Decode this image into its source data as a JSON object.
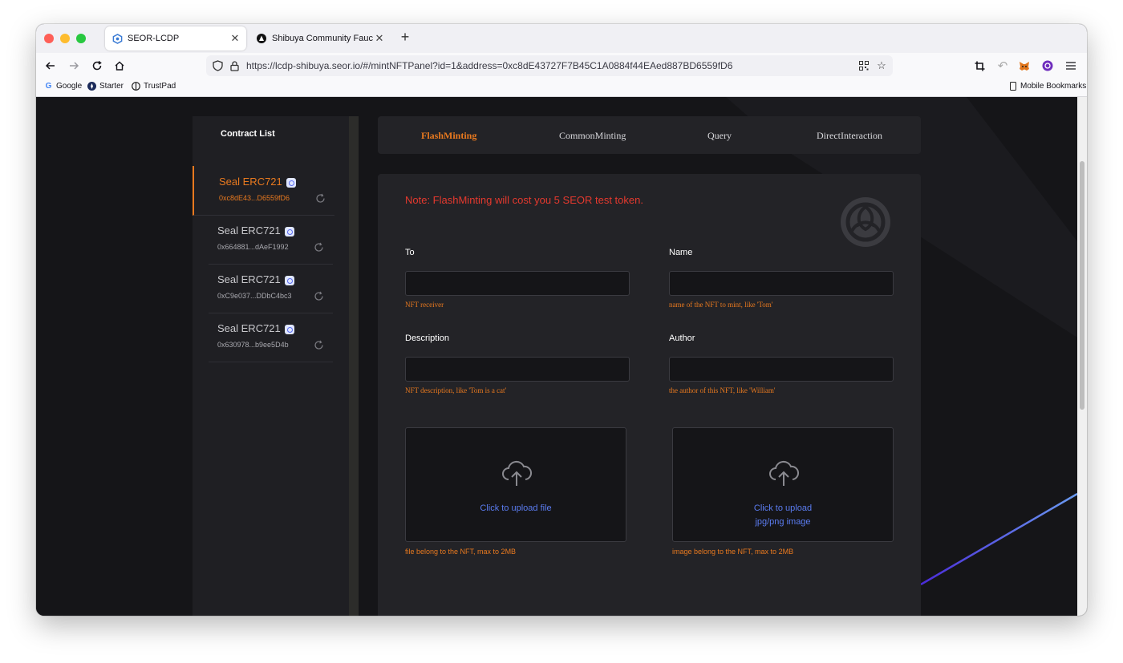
{
  "browser": {
    "tabs": [
      {
        "title": "SEOR-LCDP",
        "active": true
      },
      {
        "title": "Shibuya Community Faucet",
        "active": false
      }
    ],
    "new_tab_icon": "plus-icon",
    "url": "https://lcdp-shibuya.seor.io/#/mintNFTPanel?id=1&address=0xc8dE43727F7B45C1A0884f44EAed887BD6559fD6",
    "bookmarks": [
      {
        "label": "Google",
        "icon": "google-icon"
      },
      {
        "label": "Starter",
        "icon": "starter-icon"
      },
      {
        "label": "TrustPad",
        "icon": "trustpad-icon"
      }
    ],
    "mobile_bookmarks": "Mobile Bookmarks"
  },
  "sidebar": {
    "title": "Contract List",
    "contracts": [
      {
        "name": "Seal ERC721",
        "address": "0xc8dE43...D6559fD6",
        "selected": true
      },
      {
        "name": "Seal ERC721",
        "address": "0x664881...dAeF1992",
        "selected": false
      },
      {
        "name": "Seal ERC721",
        "address": "0xC9e037...DDbC4bc3",
        "selected": false
      },
      {
        "name": "Seal ERC721",
        "address": "0x630978...b9ee5D4b",
        "selected": false
      }
    ]
  },
  "tabs": [
    {
      "label": "FlashMinting",
      "active": true
    },
    {
      "label": "CommonMinting",
      "active": false
    },
    {
      "label": "Query",
      "active": false
    },
    {
      "label": "DirectInteraction",
      "active": false
    }
  ],
  "form": {
    "note": "Note: FlashMinting will cost you 5 SEOR test token.",
    "to": {
      "label": "To",
      "value": "",
      "hint": "NFT receiver"
    },
    "name": {
      "label": "Name",
      "value": "",
      "hint": "name of the NFT to mint, like 'Tom'"
    },
    "description": {
      "label": "Description",
      "value": "",
      "hint": "NFT description, like 'Tom is a cat'"
    },
    "author": {
      "label": "Author",
      "value": "",
      "hint": "the author of this NFT, like 'William'"
    },
    "file_upload": {
      "text": "Click to upload file",
      "hint": "file belong to the NFT, max to 2MB"
    },
    "image_upload": {
      "text_line1": "Click to upload",
      "text_line2": "jpg/png image",
      "hint": "image belong to the NFT, max to 2MB"
    }
  },
  "colors": {
    "accent": "#e8791f",
    "note_red": "#e5392e",
    "link_blue": "#5b7cf0",
    "page_bg": "#151518",
    "panel_bg": "#232327"
  }
}
